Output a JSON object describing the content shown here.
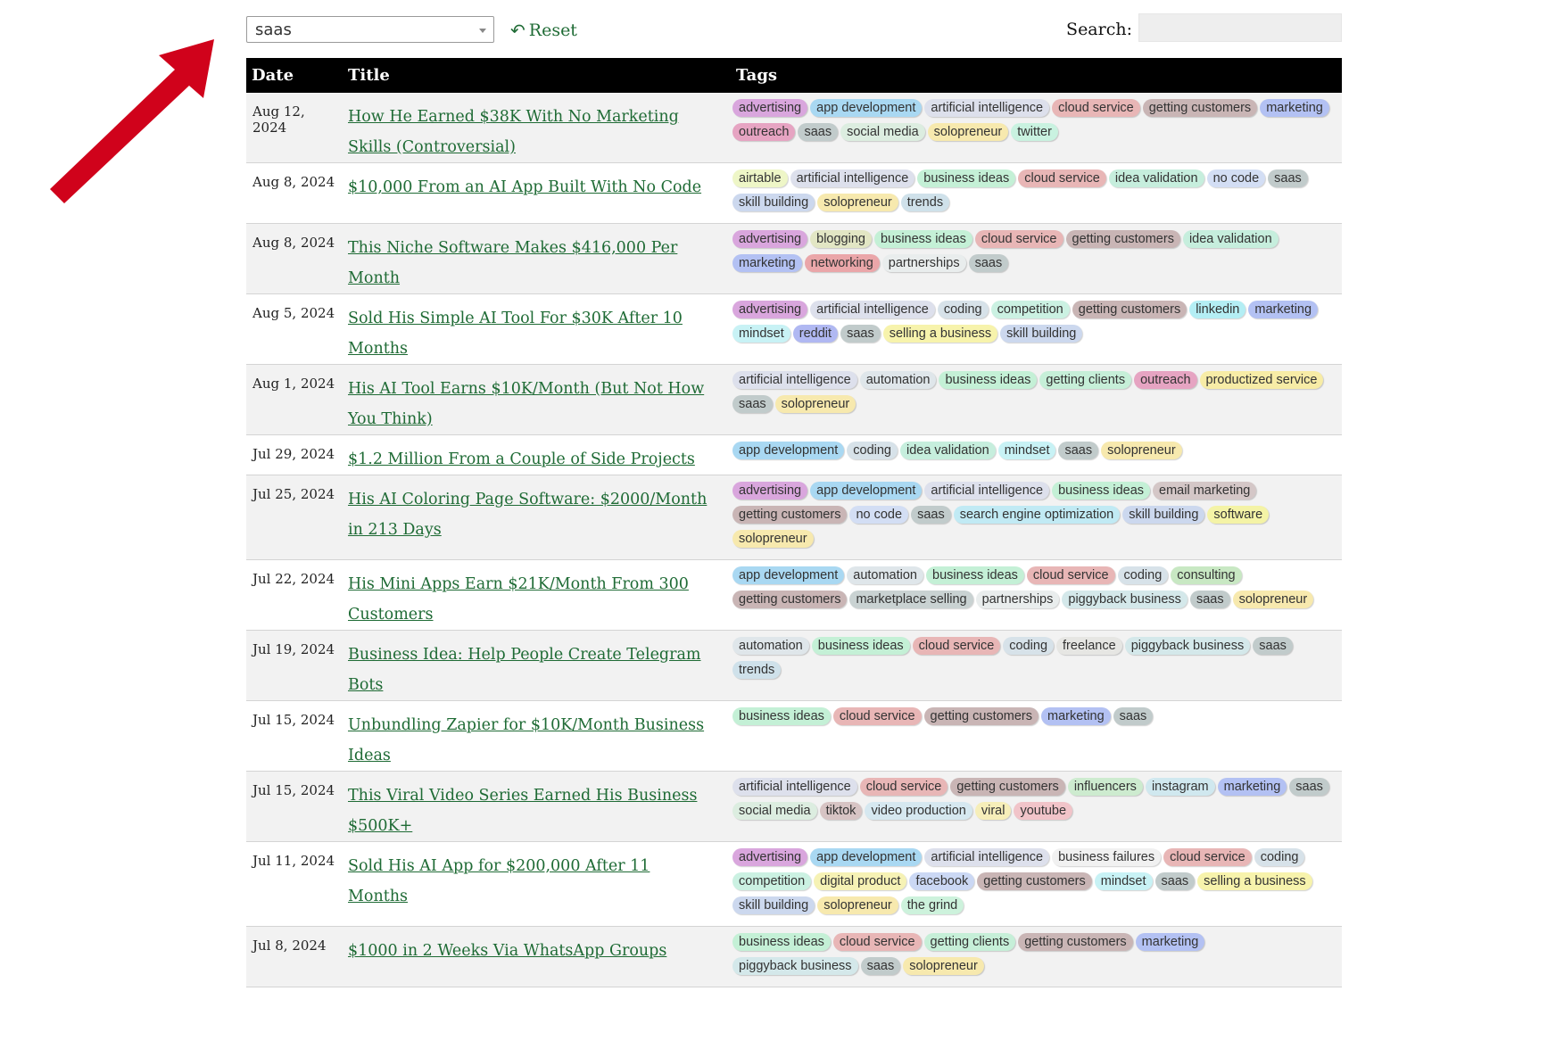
{
  "controls": {
    "filter_value": "saas",
    "reset_label": "Reset",
    "search_label": "Search:",
    "search_value": ""
  },
  "table": {
    "headers": {
      "date": "Date",
      "title": "Title",
      "tags": "Tags"
    },
    "rows": [
      {
        "date": "Aug 12, 2024",
        "title": "How He Earned $38K With No Marketing Skills (Controversial)",
        "tags": [
          "advertising",
          "app development",
          "artificial intelligence",
          "cloud service",
          "getting customers",
          "marketing",
          "outreach",
          "saas",
          "social media",
          "solopreneur",
          "twitter"
        ]
      },
      {
        "date": "Aug 8, 2024",
        "title": "$10,000 From an AI App Built With No Code",
        "tags": [
          "airtable",
          "artificial intelligence",
          "business ideas",
          "cloud service",
          "idea validation",
          "no code",
          "saas",
          "skill building",
          "solopreneur",
          "trends"
        ]
      },
      {
        "date": "Aug 8, 2024",
        "title": "This Niche Software Makes $416,000 Per Month",
        "tags": [
          "advertising",
          "blogging",
          "business ideas",
          "cloud service",
          "getting customers",
          "idea validation",
          "marketing",
          "networking",
          "partnerships",
          "saas"
        ]
      },
      {
        "date": "Aug 5, 2024",
        "title": "Sold His Simple AI Tool For $30K After 10 Months",
        "tags": [
          "advertising",
          "artificial intelligence",
          "coding",
          "competition",
          "getting customers",
          "linkedin",
          "marketing",
          "mindset",
          "reddit",
          "saas",
          "selling a business",
          "skill building"
        ]
      },
      {
        "date": "Aug 1, 2024",
        "title": "His AI Tool Earns $10K/Month (But Not How You Think)",
        "tags": [
          "artificial intelligence",
          "automation",
          "business ideas",
          "getting clients",
          "outreach",
          "productized service",
          "saas",
          "solopreneur"
        ]
      },
      {
        "date": "Jul 29, 2024",
        "title": "$1.2 Million From a Couple of Side Projects",
        "tags": [
          "app development",
          "coding",
          "idea validation",
          "mindset",
          "saas",
          "solopreneur"
        ]
      },
      {
        "date": "Jul 25, 2024",
        "title": "His AI Coloring Page Software: $2000/Month in 213 Days",
        "tags": [
          "advertising",
          "app development",
          "artificial intelligence",
          "business ideas",
          "email marketing",
          "getting customers",
          "no code",
          "saas",
          "search engine optimization",
          "skill building",
          "software",
          "solopreneur"
        ]
      },
      {
        "date": "Jul 22, 2024",
        "title": "His Mini Apps Earn $21K/Month From 300 Customers",
        "tags": [
          "app development",
          "automation",
          "business ideas",
          "cloud service",
          "coding",
          "consulting",
          "getting customers",
          "marketplace selling",
          "partnerships",
          "piggyback business",
          "saas",
          "solopreneur"
        ]
      },
      {
        "date": "Jul 19, 2024",
        "title": "Business Idea: Help People Create Telegram Bots",
        "tags": [
          "automation",
          "business ideas",
          "cloud service",
          "coding",
          "freelance",
          "piggyback business",
          "saas",
          "trends"
        ]
      },
      {
        "date": "Jul 15, 2024",
        "title": "Unbundling Zapier for $10K/Month Business Ideas",
        "tags": [
          "business ideas",
          "cloud service",
          "getting customers",
          "marketing",
          "saas"
        ]
      },
      {
        "date": "Jul 15, 2024",
        "title": "This Viral Video Series Earned His Business $500K+",
        "tags": [
          "artificial intelligence",
          "cloud service",
          "getting customers",
          "influencers",
          "instagram",
          "marketing",
          "saas",
          "social media",
          "tiktok",
          "video production",
          "viral",
          "youtube"
        ]
      },
      {
        "date": "Jul 11, 2024",
        "title": "Sold His AI App for $200,000 After 11 Months",
        "tags": [
          "advertising",
          "app development",
          "artificial intelligence",
          "business failures",
          "cloud service",
          "coding",
          "competition",
          "digital product",
          "facebook",
          "getting customers",
          "mindset",
          "saas",
          "selling a business",
          "skill building",
          "solopreneur",
          "the grind"
        ]
      },
      {
        "date": "Jul 8, 2024",
        "title": "$1000 in 2 Weeks Via WhatsApp Groups",
        "tags": [
          "business ideas",
          "cloud service",
          "getting clients",
          "getting customers",
          "marketing",
          "piggyback business",
          "saas",
          "solopreneur"
        ]
      }
    ]
  },
  "tag_colors": {
    "advertising": "#d9a6dd",
    "app development": "#a9d8f2",
    "artificial intelligence": "#dde0ec",
    "cloud service": "#e8b6b6",
    "getting customers": "#c9b5b5",
    "marketing": "#b3c1f3",
    "outreach": "#e6a4c2",
    "saas": "#c1cbcb",
    "social media": "#dcede0",
    "solopreneur": "#f7e9ae",
    "twitter": "#c9f2e0",
    "airtable": "#eef6c7",
    "business ideas": "#c4f0d6",
    "idea validation": "#c6eedd",
    "no code": "#d3def4",
    "skill building": "#ccd8ee",
    "trends": "#cfe1ea",
    "blogging": "#e2e6c4",
    "networking": "#eaa6a9",
    "partnerships": "#e9eded",
    "coding": "#d7e2e9",
    "competition": "#cbf1e2",
    "linkedin": "#b4eef4",
    "mindset": "#c8f2f5",
    "reddit": "#b0b8f2",
    "selling a business": "#f7f3ac",
    "automation": "#dfe6ea",
    "getting clients": "#c6efd8",
    "productized service": "#f7eca6",
    "email marketing": "#d4c7c7",
    "search engine optimization": "#c1eaf4",
    "software": "#f4f3a6",
    "consulting": "#c8e8c3",
    "marketplace selling": "#c9d2d2",
    "piggyback business": "#d4e8ea",
    "freelance": "#e6e6e3",
    "influencers": "#cdebcf",
    "instagram": "#d0e8ef",
    "tiktok": "#d7c4c4",
    "video production": "#d6e8f0",
    "viral": "#f6eeb9",
    "youtube": "#f1c4c9",
    "business failures": "#f1f1f1",
    "digital product": "#f6f2b5",
    "facebook": "#cbd8f4",
    "the grind": "#cdf2dc"
  },
  "accent_colors": {
    "link": "#1f6b35",
    "header_bg": "#000000",
    "arrow": "#d0021b"
  }
}
